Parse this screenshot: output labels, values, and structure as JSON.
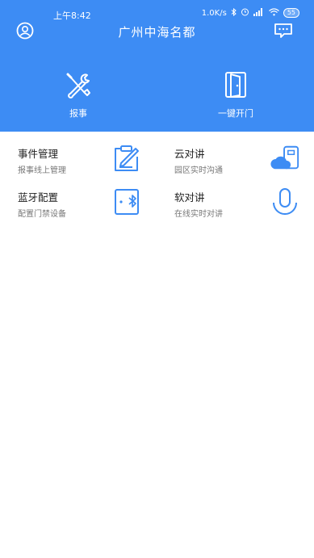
{
  "status_bar": {
    "time": "上午8:42",
    "net_speed": "1.0K/s",
    "battery": "55"
  },
  "header": {
    "title": "广州中海名都",
    "profile_icon": "user-circle-icon",
    "message_icon": "chat-bubble-icon",
    "background_color": "#3d8cf4"
  },
  "quick_actions": [
    {
      "label": "报事",
      "icon": "wrench-screwdriver-icon"
    },
    {
      "label": "一键开门",
      "icon": "door-icon"
    }
  ],
  "features": [
    {
      "title": "事件管理",
      "subtitle": "报事线上管理",
      "icon": "clipboard-edit-icon"
    },
    {
      "title": "云对讲",
      "subtitle": "园区实时沟通",
      "icon": "cloud-intercom-icon"
    },
    {
      "title": "蓝牙配置",
      "subtitle": "配置门禁设备",
      "icon": "bluetooth-door-icon"
    },
    {
      "title": "软对讲",
      "subtitle": "在线实时对讲",
      "icon": "microphone-icon"
    }
  ],
  "accent_color": "#3d8cf4"
}
